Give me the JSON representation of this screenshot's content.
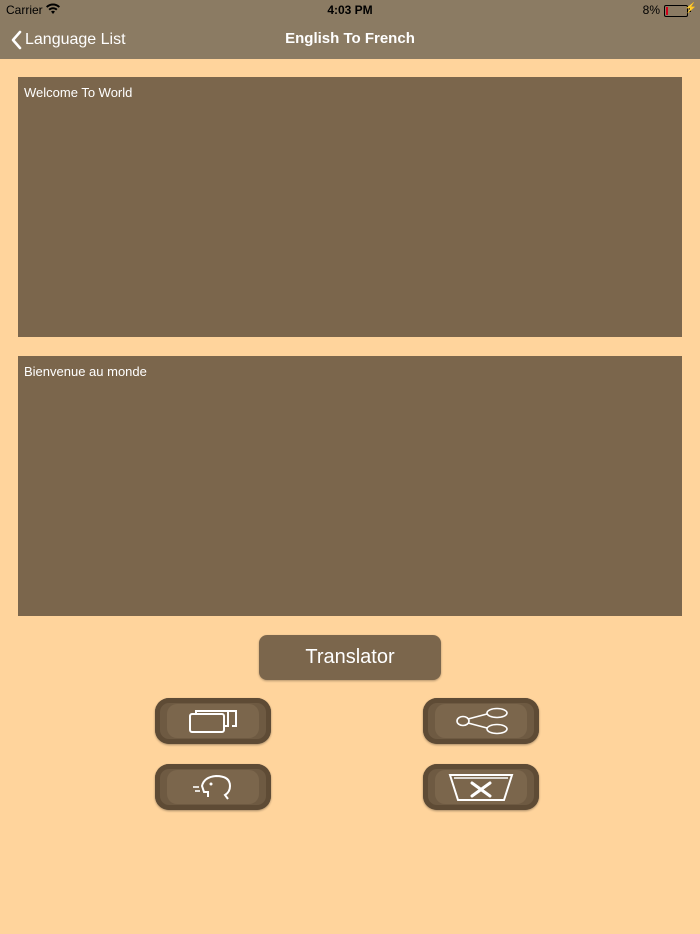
{
  "status_bar": {
    "carrier": "Carrier",
    "time": "4:03 PM",
    "battery_percent": "8%",
    "battery_level": 0.08,
    "battery_color": "#D0021B"
  },
  "nav": {
    "back_label": "Language List",
    "title": "English To French"
  },
  "source": {
    "text": "Welcome To World"
  },
  "target": {
    "text": "Bienvenue au monde"
  },
  "actions": {
    "translate_label": "Translator",
    "icons": [
      "copy-icon",
      "share-icon",
      "speak-icon",
      "delete-icon"
    ]
  },
  "colors": {
    "background": "#FFD49C",
    "navbar": "#8B7B63",
    "panel": "#7B664C"
  }
}
